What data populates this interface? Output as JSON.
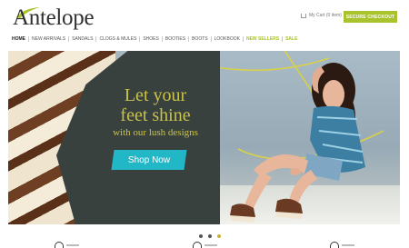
{
  "header": {
    "logo_text": "Antelope",
    "cart_text": "My Cart (0 item)",
    "checkout_label": "SECURE CHECKOUT"
  },
  "nav": {
    "items": [
      {
        "label": "HOME",
        "style": "active"
      },
      {
        "label": "NEW ARRIVALS",
        "style": "normal"
      },
      {
        "label": "SANDALS",
        "style": "normal"
      },
      {
        "label": "CLOGS & MULES",
        "style": "normal"
      },
      {
        "label": "SHOES",
        "style": "normal"
      },
      {
        "label": "BOOTIES",
        "style": "normal"
      },
      {
        "label": "BOOTS",
        "style": "normal"
      },
      {
        "label": "LOOKBOOK",
        "style": "normal"
      },
      {
        "label": "NEW SELLERS",
        "style": "accent"
      },
      {
        "label": "SALE",
        "style": "accent"
      }
    ]
  },
  "hero": {
    "headline_line1": "Let your",
    "headline_line2": "feet shine",
    "subhead": "with our lush designs",
    "cta_label": "Shop Now"
  },
  "carousel": {
    "slide_count": 3,
    "active_index": 2
  },
  "colors": {
    "accent_green": "#a8c32c",
    "cta_teal": "#22b7c6",
    "headline_gold": "#c9c24a",
    "dark_panel": "#39413e"
  }
}
